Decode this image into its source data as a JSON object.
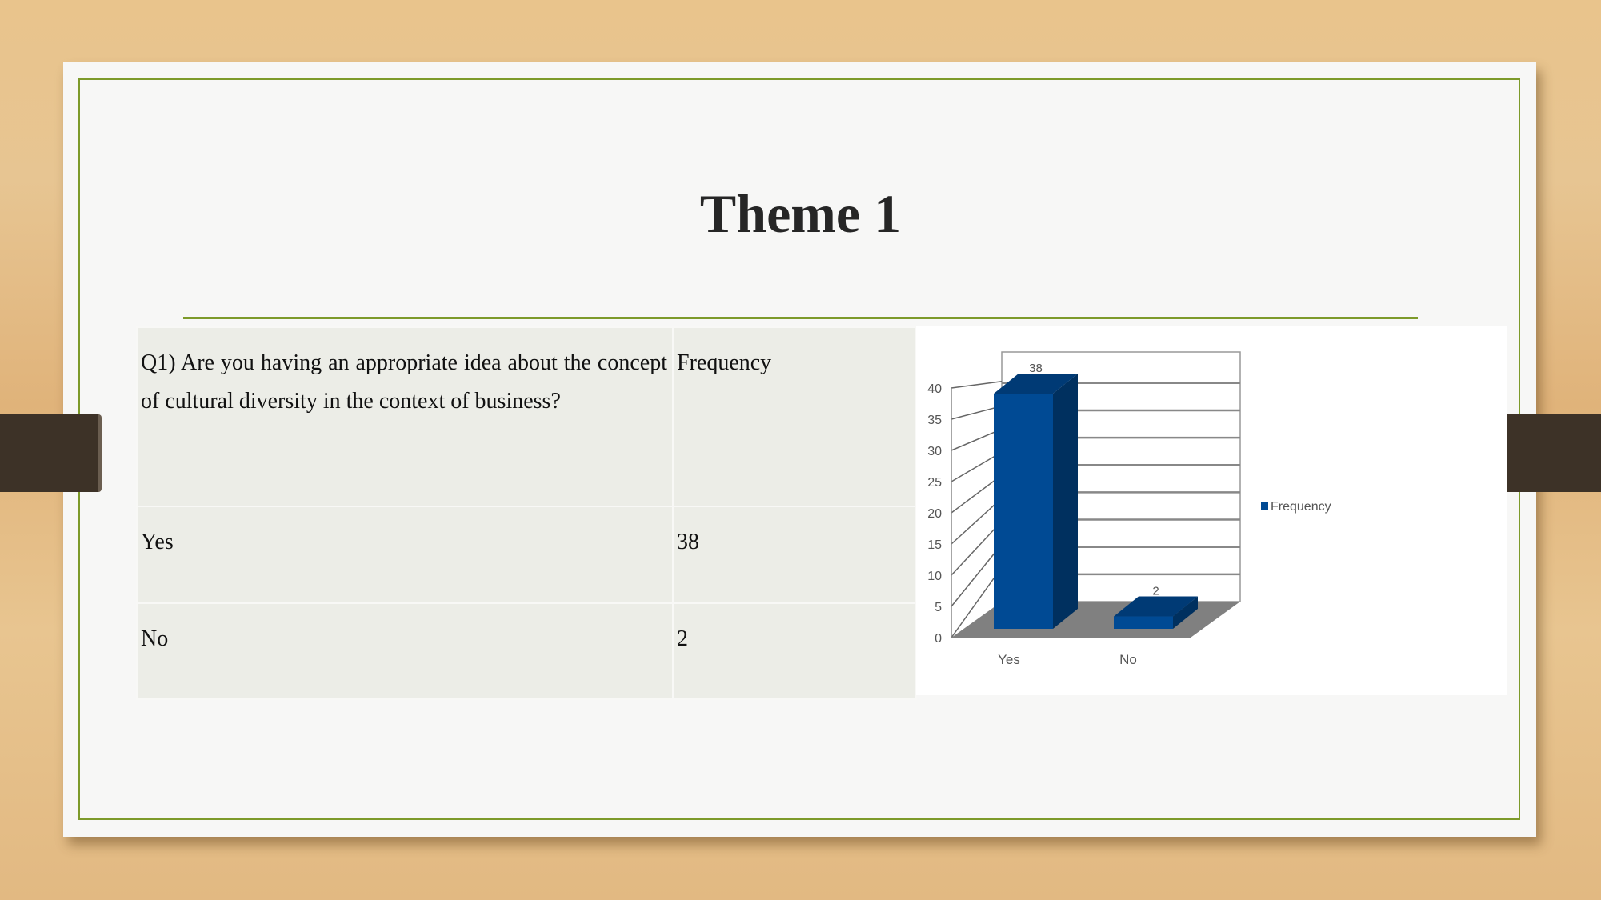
{
  "title": "Theme 1",
  "table": {
    "header": [
      "Q1) Are you having an appropriate idea about the concept of cultural diversity in the context of business?",
      "Frequency"
    ],
    "rows": [
      [
        "Yes",
        "38"
      ],
      [
        "No",
        "2"
      ]
    ]
  },
  "chart_data": {
    "type": "bar",
    "style": "3d-column",
    "categories": [
      "Yes",
      "No"
    ],
    "series": [
      {
        "name": "Frequency",
        "values": [
          38,
          2
        ],
        "color": "#004a94"
      }
    ],
    "data_labels": [
      "38",
      "2"
    ],
    "ylim": [
      0,
      40
    ],
    "yticks": [
      0,
      5,
      10,
      15,
      20,
      25,
      30,
      35,
      40
    ],
    "grid": true,
    "legend": "right"
  },
  "colors": {
    "accent": "#7d9a2a",
    "bar": "#004a94",
    "floor": "#808080"
  }
}
